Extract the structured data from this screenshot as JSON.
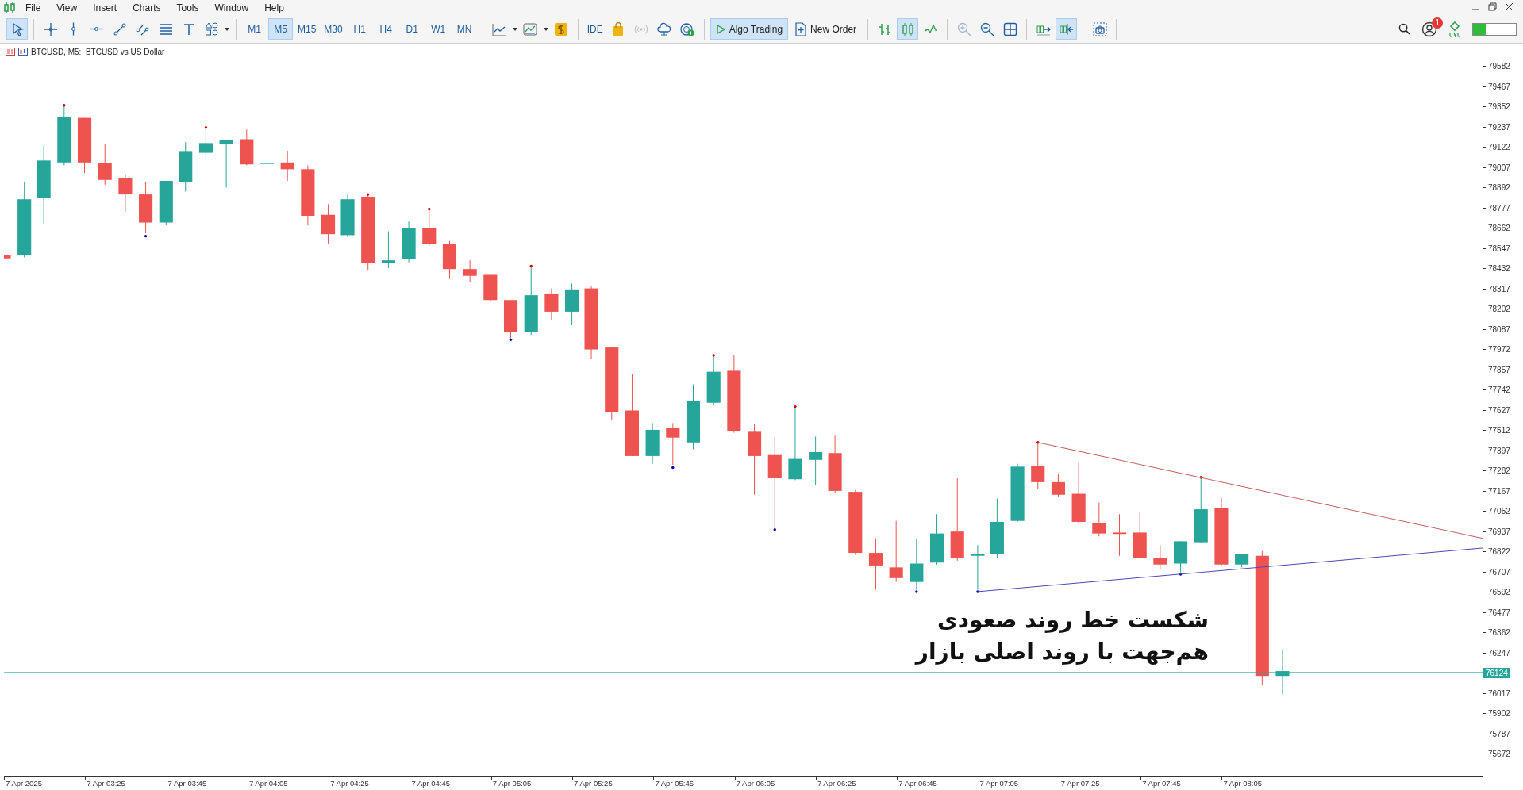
{
  "menu": [
    {
      "label": "File"
    },
    {
      "label": "View"
    },
    {
      "label": "Insert"
    },
    {
      "label": "Charts"
    },
    {
      "label": "Tools"
    },
    {
      "label": "Window"
    },
    {
      "label": "Help"
    }
  ],
  "toolbar": {
    "drawing_tools": [
      {
        "selected": true
      },
      {
        "selected": false
      },
      {
        "selected": false
      },
      {
        "selected": false
      },
      {
        "selected": false
      },
      {
        "selected": false
      },
      {
        "selected": false
      },
      {
        "selected": false
      },
      {
        "selected": false
      }
    ],
    "timeframes": [
      {
        "label": "M1",
        "selected": false
      },
      {
        "label": "M5",
        "selected": true
      },
      {
        "label": "M15",
        "selected": false
      },
      {
        "label": "M30",
        "selected": false
      },
      {
        "label": "H1",
        "selected": false
      },
      {
        "label": "H4",
        "selected": false
      },
      {
        "label": "D1",
        "selected": false
      },
      {
        "label": "W1",
        "selected": false
      },
      {
        "label": "MN",
        "selected": false
      }
    ],
    "ide": {
      "label": "IDE"
    },
    "algo_trading": {
      "label": "Algo Trading",
      "on": true
    },
    "new_order": {
      "label": "New Order"
    },
    "chart_modes": [
      {
        "selected": false
      },
      {
        "selected": true
      },
      {
        "selected": false
      }
    ],
    "autoscroll": {
      "selected": false
    },
    "chart_shift": {
      "selected": true
    },
    "notifications": {
      "count": "1"
    }
  },
  "chart": {
    "title": "BTCUSD, M5:  BTCUSD vs US Dollar",
    "annotation": [
      "شکست خط روند صعودی",
      "هم‌جهت با روند اصلی بازار"
    ],
    "price_axis": [
      {
        "kind": "tick",
        "label": "79582"
      },
      {
        "kind": "tick",
        "label": "79467"
      },
      {
        "kind": "tick",
        "label": "79352"
      },
      {
        "kind": "tick",
        "label": "79237"
      },
      {
        "kind": "tick",
        "label": "79122"
      },
      {
        "kind": "tick",
        "label": "79007"
      },
      {
        "kind": "tick",
        "label": "78892"
      },
      {
        "kind": "tick",
        "label": "78777"
      },
      {
        "kind": "tick",
        "label": "78662"
      },
      {
        "kind": "tick",
        "label": "78547"
      },
      {
        "kind": "tick",
        "label": "78432"
      },
      {
        "kind": "tick",
        "label": "78317"
      },
      {
        "kind": "tick",
        "label": "78202"
      },
      {
        "kind": "tick",
        "label": "78087"
      },
      {
        "kind": "tick",
        "label": "77972"
      },
      {
        "kind": "tick",
        "label": "77857"
      },
      {
        "kind": "tick",
        "label": "77742"
      },
      {
        "kind": "tick",
        "label": "77627"
      },
      {
        "kind": "tick",
        "label": "77512"
      },
      {
        "kind": "tick",
        "label": "77397"
      },
      {
        "kind": "tick",
        "label": "77282"
      },
      {
        "kind": "tick",
        "label": "77167"
      },
      {
        "kind": "tick",
        "label": "77052"
      },
      {
        "kind": "tick",
        "label": "76937"
      },
      {
        "kind": "tick",
        "label": "76822"
      },
      {
        "kind": "tick",
        "label": "76707"
      },
      {
        "kind": "tick",
        "label": "76592"
      },
      {
        "kind": "tick",
        "label": "76477"
      },
      {
        "kind": "tick",
        "label": "76362"
      },
      {
        "kind": "tick",
        "label": "76247"
      },
      {
        "kind": "current",
        "label": "76124"
      },
      {
        "kind": "tick",
        "label": "76017"
      },
      {
        "kind": "tick",
        "label": "75902"
      },
      {
        "kind": "tick",
        "label": "75787"
      },
      {
        "kind": "tick",
        "label": "75672"
      }
    ],
    "time_axis": [
      "7 Apr 2025",
      "7 Apr 03:25",
      "7 Apr 03:45",
      "7 Apr 04:05",
      "7 Apr 04:25",
      "7 Apr 04:45",
      "7 Apr 05:05",
      "7 Apr 05:25",
      "7 Apr 05:45",
      "7 Apr 06:05",
      "7 Apr 06:25",
      "7 Apr 06:45",
      "7 Apr 07:05",
      "7 Apr 07:25",
      "7 Apr 07:45",
      "7 Apr 08:05"
    ]
  }
}
